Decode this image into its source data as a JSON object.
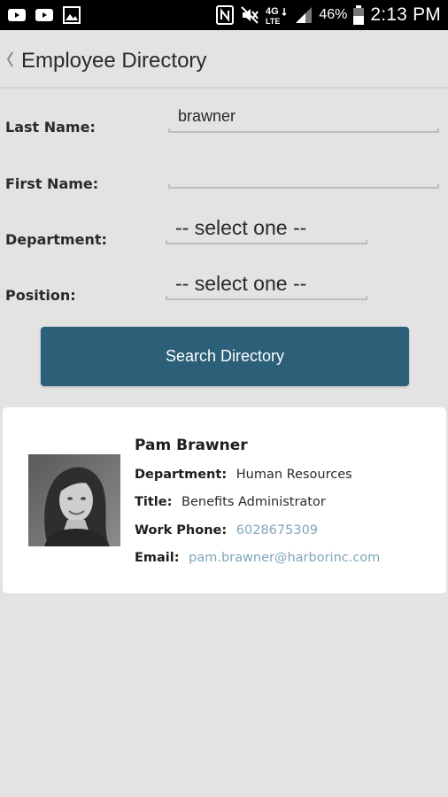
{
  "status_bar": {
    "battery": "46%",
    "time": "2:13 PM",
    "icons": [
      "youtube-icon",
      "youtube-icon",
      "gallery-icon",
      "nfc-icon",
      "mute-icon",
      "4g-lte-icon",
      "signal-icon",
      "battery-icon"
    ]
  },
  "header": {
    "title": "Employee Directory",
    "back_icon": "chevron-left-icon"
  },
  "form": {
    "last_name": {
      "label": "Last Name:",
      "value": "brawner"
    },
    "first_name": {
      "label": "First Name:",
      "value": ""
    },
    "department": {
      "label": "Department:",
      "selected": "-- select one --"
    },
    "position": {
      "label": "Position:",
      "selected": "-- select one --"
    },
    "search_button": "Search Directory"
  },
  "result": {
    "name": "Pam Brawner",
    "department": {
      "label": "Department:",
      "value": "Human Resources"
    },
    "title": {
      "label": "Title:",
      "value": "Benefits Administrator"
    },
    "work_phone": {
      "label": "Work Phone:",
      "value": "6028675309"
    },
    "email": {
      "label": "Email:",
      "value": "pam.brawner@harborinc.com"
    }
  },
  "colors": {
    "button": "#2b6078",
    "link": "#7fa6ba",
    "background": "#e3e3e3"
  }
}
